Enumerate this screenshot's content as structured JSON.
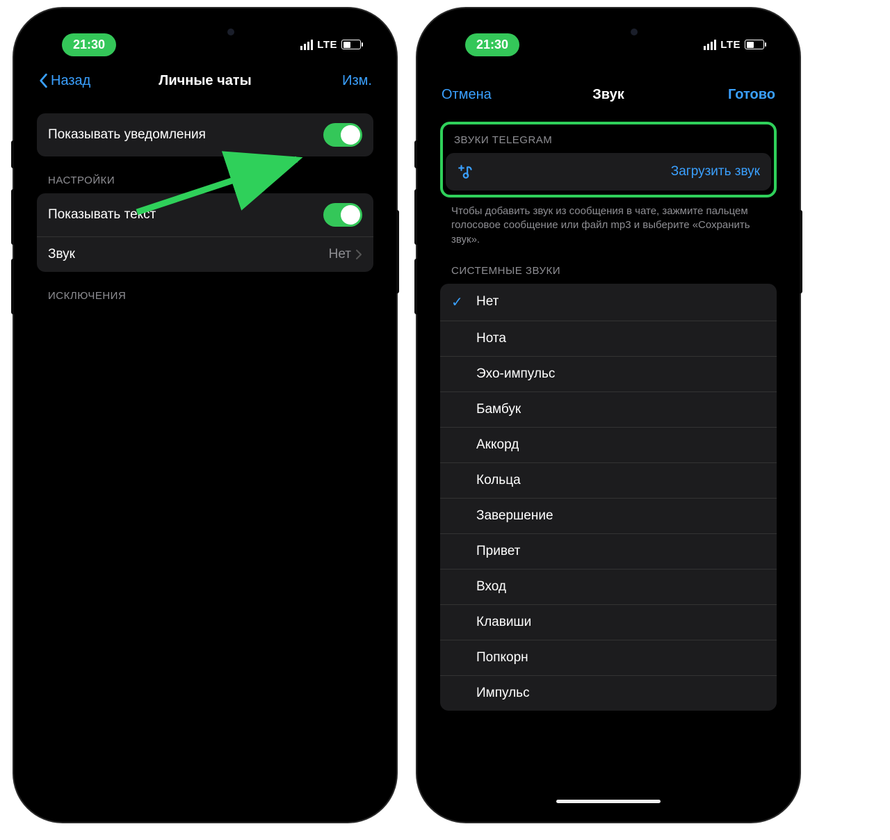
{
  "status": {
    "time": "21:30",
    "network": "LTE"
  },
  "left_screen": {
    "nav": {
      "back": "Назад",
      "title": "Личные чаты",
      "edit": "Изм."
    },
    "notifications": {
      "label": "Показывать уведомления",
      "on": true
    },
    "settings_header": "НАСТРОЙКИ",
    "show_text": {
      "label": "Показывать текст",
      "on": true
    },
    "sound": {
      "label": "Звук",
      "value": "Нет"
    },
    "exceptions_header": "ИСКЛЮЧЕНИЯ"
  },
  "right_screen": {
    "nav": {
      "cancel": "Отмена",
      "title": "Звук",
      "done": "Готово"
    },
    "telegram_sounds_header": "ЗВУКИ TELEGRAM",
    "upload_label": "Загрузить звук",
    "upload_footer": "Чтобы добавить звук из сообщения в чате, зажмите пальцем голосовое сообщение или файл mp3 и выберите «Сохранить звук».",
    "system_sounds_header": "СИСТЕМНЫЕ ЗВУКИ",
    "sounds": [
      {
        "label": "Нет",
        "selected": true
      },
      {
        "label": "Нота"
      },
      {
        "label": "Эхо-импульс"
      },
      {
        "label": "Бамбук"
      },
      {
        "label": "Аккорд"
      },
      {
        "label": "Кольца"
      },
      {
        "label": "Завершение"
      },
      {
        "label": "Привет"
      },
      {
        "label": "Вход"
      },
      {
        "label": "Клавиши"
      },
      {
        "label": "Попкорн"
      },
      {
        "label": "Импульс"
      }
    ]
  },
  "colors": {
    "accent_blue": "#3aa0ff",
    "toggle_green": "#34c759",
    "highlight_green": "#2fd05a"
  }
}
